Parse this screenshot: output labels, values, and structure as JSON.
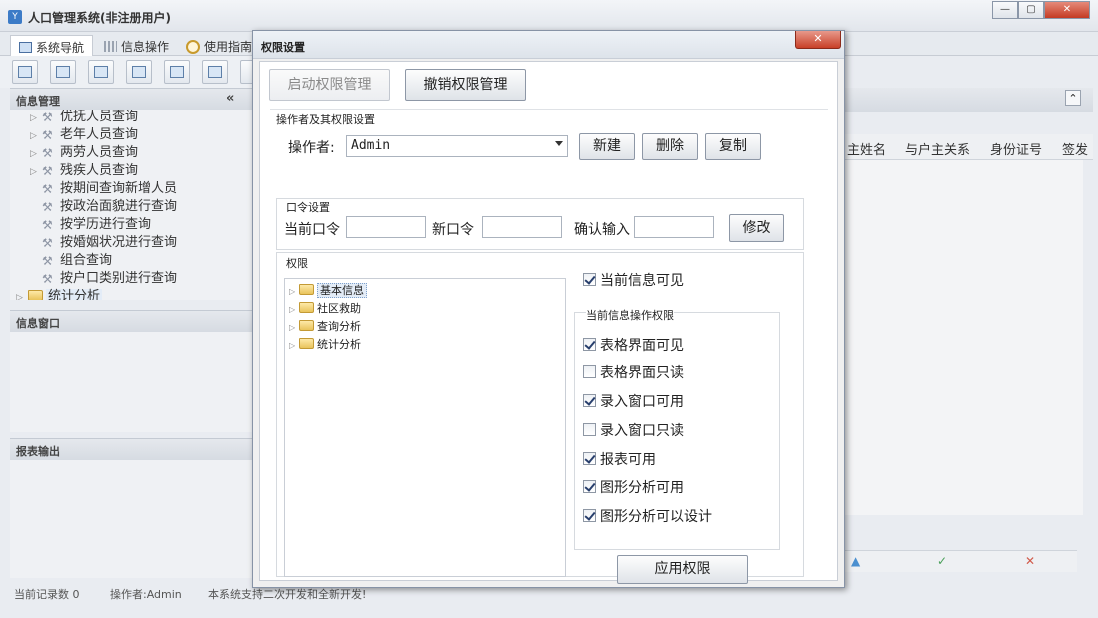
{
  "window": {
    "title": "人口管理系统(非注册用户)",
    "minimize": "—",
    "maximize": "▢",
    "close": "✕"
  },
  "main_tabs": [
    {
      "label": "系统导航"
    },
    {
      "label": "信息操作"
    },
    {
      "label": "使用指南"
    }
  ],
  "sidebar": {
    "info_header": "信息管理",
    "collapse_icon": "«",
    "tree": [
      {
        "label": "优抚人员查询",
        "expandable": true
      },
      {
        "label": "老年人员查询",
        "expandable": true
      },
      {
        "label": "两劳人员查询",
        "expandable": true
      },
      {
        "label": "残疾人员查询",
        "expandable": true
      },
      {
        "label": "按期间查询新增人员"
      },
      {
        "label": "按政治面貌进行查询"
      },
      {
        "label": "按学历进行查询"
      },
      {
        "label": "按婚姻状况进行查询"
      },
      {
        "label": "组合查询"
      },
      {
        "label": "按户口类别进行查询"
      },
      {
        "label": "统计分析",
        "folder": true
      }
    ],
    "window_header": "信息窗口",
    "report_header": "报表输出"
  },
  "right_panel": {
    "collapse_icon": "⌃",
    "columns": [
      "主姓名",
      "与户主关系",
      "身份证号",
      "签发"
    ],
    "up_icon": "▲",
    "check_icon": "✓",
    "cross_icon": "✕"
  },
  "status": {
    "records": "当前记录数 0",
    "operator": "操作者:Admin",
    "note": "本系统支持二次开发和全新开发!"
  },
  "dialog": {
    "title": "权限设置",
    "close": "✕",
    "enable_btn": "启动权限管理",
    "revoke_btn": "撤销权限管理",
    "operator_group": "操作者及其权限设置",
    "operator_label": "操作者:",
    "operator_value": "Admin",
    "new_btn": "新建",
    "delete_btn": "删除",
    "copy_btn": "复制",
    "password_group": "口令设置",
    "current_pw_label": "当前口令",
    "new_pw_label": "新口令",
    "confirm_label": "确认输入",
    "modify_btn": "修改",
    "perm_group": "权限",
    "perm_tree": [
      "基本信息",
      "社区救助",
      "查询分析",
      "统计分析"
    ],
    "current_visible": {
      "label": "当前信息可见",
      "checked": true
    },
    "ops_group": "当前信息操作权限",
    "ops": [
      {
        "label": "表格界面可见",
        "checked": true
      },
      {
        "label": "表格界面只读",
        "checked": false
      },
      {
        "label": "录入窗口可用",
        "checked": true
      },
      {
        "label": "录入窗口只读",
        "checked": false
      },
      {
        "label": "报表可用",
        "checked": true
      },
      {
        "label": "图形分析可用",
        "checked": true
      },
      {
        "label": "图形分析可以设计",
        "checked": true
      }
    ],
    "apply_btn": "应用权限"
  }
}
